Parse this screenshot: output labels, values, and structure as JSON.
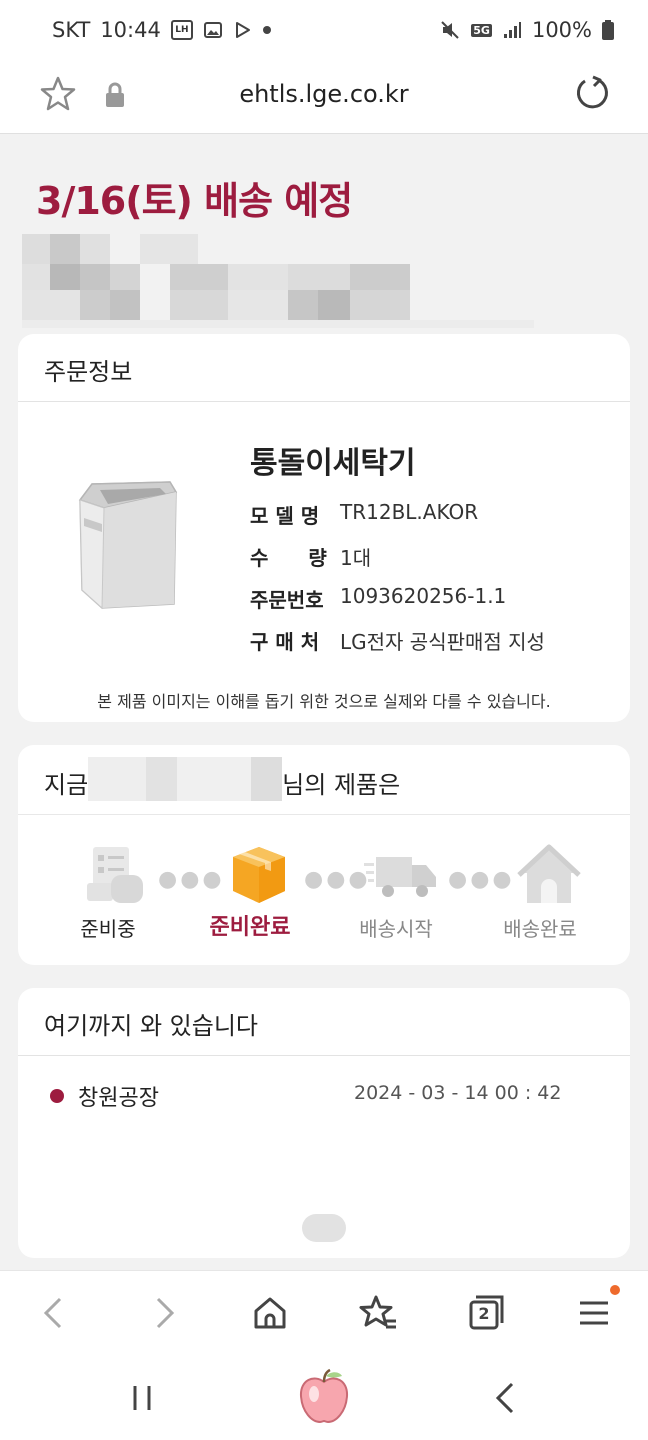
{
  "statusbar": {
    "carrier": "SKT",
    "time": "10:44",
    "lh_badge": "LH",
    "network": "5G",
    "battery": "100%"
  },
  "urlbar": {
    "url": "ehtls.lge.co.kr"
  },
  "page": {
    "delivery_title": "3/16(토) 배송 예정"
  },
  "order": {
    "section_title": "주문정보",
    "product_name": "통돌이세탁기",
    "rows": [
      {
        "label": "모 델 명",
        "value": "TR12BL.AKOR"
      },
      {
        "label": "수　　량",
        "value": "1대"
      },
      {
        "label": "주문번호",
        "value": "1093620256-1.1"
      },
      {
        "label": "구 매 처",
        "value": "LG전자 공식판매점 지성"
      }
    ],
    "image_note": "본 제품 이미지는 이해를 돕기 위한 것으로 실제와 다를 수 있습니다."
  },
  "status": {
    "prefix": "지금",
    "suffix": "님의 제품은",
    "steps": [
      {
        "label": "준비중",
        "state": "done",
        "color": "#222222"
      },
      {
        "label": "준비완료",
        "state": "current",
        "color": "#9d1c3f"
      },
      {
        "label": "배송시작",
        "state": "pending",
        "color": "#888888"
      },
      {
        "label": "배송완료",
        "state": "pending",
        "color": "#888888"
      }
    ]
  },
  "tracking": {
    "section_title": "여기까지 와 있습니다",
    "events": [
      {
        "place": "창원공장",
        "datetime": "2024 - 03 - 14   00 : 42"
      }
    ]
  },
  "toolbar": {
    "tabs_count": "2"
  },
  "colors": {
    "brand": "#9d1c3f",
    "accent_orange": "#f5a623",
    "notification_dot": "#ee6a2c"
  },
  "icons": {
    "product_image": "washing-machine",
    "steps": [
      "checklist-icon",
      "box-icon",
      "truck-icon",
      "house-icon"
    ],
    "toolbar": [
      "back-icon",
      "forward-icon",
      "home-icon",
      "bookmarks-icon",
      "tabs-icon",
      "menu-icon"
    ],
    "navbar": [
      "recent-apps-icon",
      "home-apple-icon",
      "back-nav-icon"
    ]
  }
}
